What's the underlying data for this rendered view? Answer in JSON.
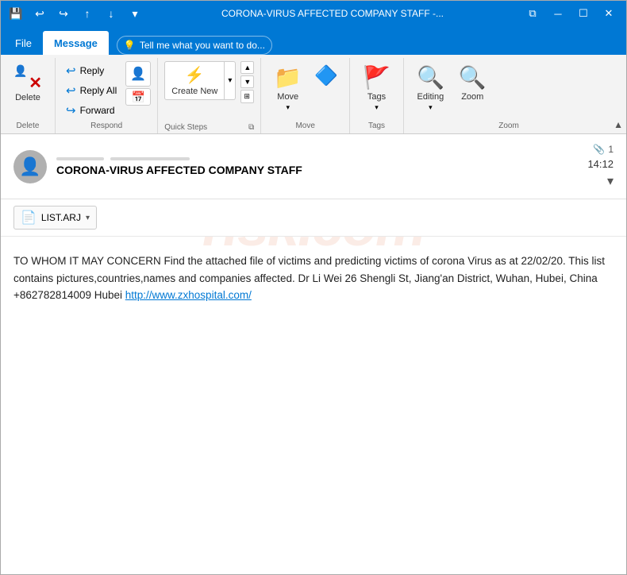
{
  "titlebar": {
    "title": "CORONA-VIRUS AFFECTED COMPANY STAFF -...",
    "qat": {
      "save": "💾",
      "undo": "↩",
      "redo": "↪",
      "up": "↑",
      "down": "↓",
      "dropdown": "▾"
    },
    "controls": {
      "restore": "⧉",
      "minimize": "─",
      "maximize": "☐",
      "close": "✕"
    }
  },
  "tabs": [
    {
      "id": "file",
      "label": "File",
      "active": false
    },
    {
      "id": "message",
      "label": "Message",
      "active": true
    },
    {
      "id": "tellme",
      "label": "💡 Tell me what you want to do...",
      "active": false
    }
  ],
  "ribbon": {
    "groups": [
      {
        "id": "delete",
        "label": "Delete",
        "buttons": [
          {
            "id": "delete-btn",
            "icon": "✕",
            "label": "Delete"
          }
        ]
      },
      {
        "id": "respond",
        "label": "Respond",
        "buttons": [
          {
            "id": "reply-btn",
            "icon": "↩",
            "label": "Reply"
          },
          {
            "id": "reply-all-btn",
            "icon": "↩↩",
            "label": "Reply All"
          },
          {
            "id": "forward-btn",
            "icon": "→",
            "label": "Forward"
          }
        ]
      },
      {
        "id": "quicksteps",
        "label": "Quick Steps",
        "buttons": [
          {
            "id": "createnew-btn",
            "icon": "⚡",
            "label": "Create New"
          }
        ]
      },
      {
        "id": "move",
        "label": "Move",
        "buttons": [
          {
            "id": "move-btn",
            "icon": "📁",
            "label": "Move"
          },
          {
            "id": "onenote-btn",
            "icon": "🔷",
            "label": ""
          }
        ]
      },
      {
        "id": "tags",
        "label": "Tags",
        "buttons": [
          {
            "id": "tags-btn",
            "icon": "🚩",
            "label": "Tags"
          }
        ]
      },
      {
        "id": "find",
        "label": "Zoom",
        "buttons": [
          {
            "id": "editing-btn",
            "icon": "🔍",
            "label": "Editing"
          },
          {
            "id": "zoom-btn",
            "icon": "🔍",
            "label": "Zoom"
          }
        ]
      }
    ]
  },
  "email": {
    "sender": {
      "avatar_icon": "👤",
      "name_masked": "████████████",
      "address_masked": "████████████"
    },
    "subject": "CORONA-VIRUS AFFECTED COMPANY STAFF",
    "timestamp": "14:12",
    "attachment_count": "1",
    "attachment_icon": "📎",
    "attachment_file": "LIST.ARJ",
    "body_text": "TO WHOM IT MAY CONCERN Find the attached file of victims and predicting victims of corona Virus as at 22/02/20. This list contains pictures,countries,names and companies affected. Dr Li Wei 26 Shengli St, Jiang'an District, Wuhan, Hubei, China +862782814009 Hubei ",
    "body_link": "http://www.zxhospital.com/",
    "watermark": "risk.com"
  }
}
